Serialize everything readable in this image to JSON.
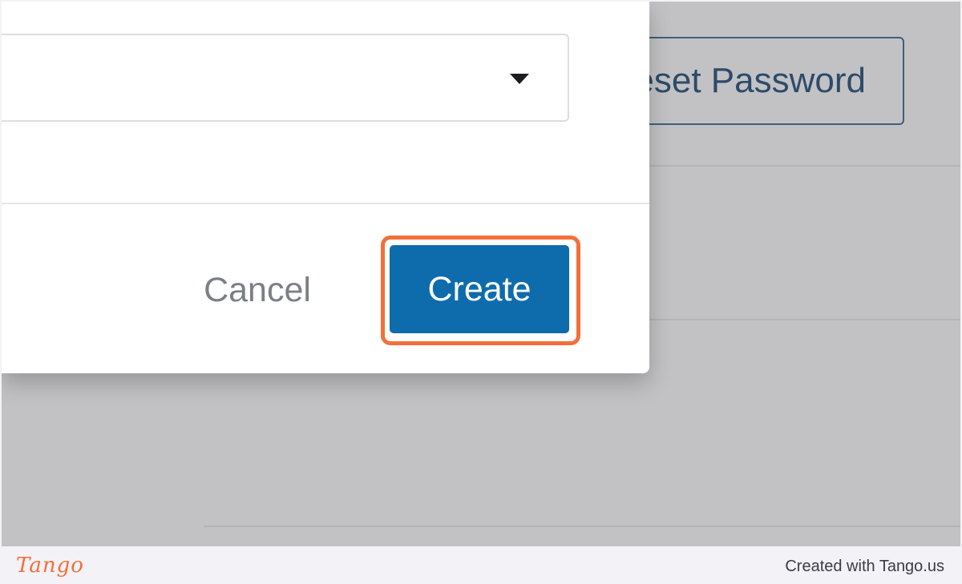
{
  "background": {
    "reset_password_label": "Reset Password"
  },
  "dialog": {
    "select_value": "",
    "cancel_label": "Cancel",
    "create_label": "Create"
  },
  "footer": {
    "logo_text": "Tango",
    "credit_text": "Created with Tango.us"
  },
  "icons": {
    "select_caret": "caret-down-icon"
  },
  "colors": {
    "primary": "#0e6cad",
    "highlight": "#f36f3a",
    "overlay": "#c2c2c4"
  }
}
